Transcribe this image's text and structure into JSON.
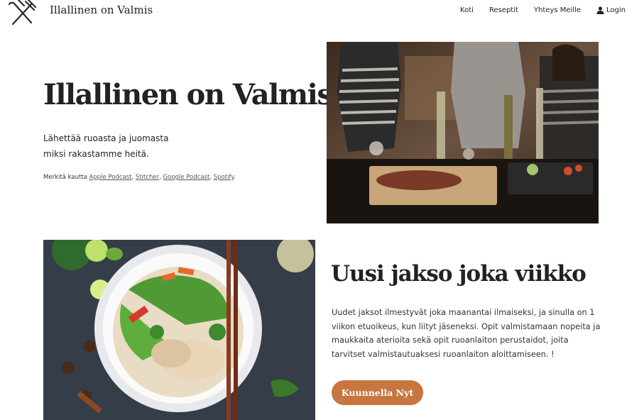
{
  "header": {
    "brand": "Illallinen on Valmis",
    "logo_icon": "fork-and-knife-icon",
    "nav": [
      {
        "label": "Koti"
      },
      {
        "label": "Reseptit"
      },
      {
        "label": "Yhteys Meille"
      }
    ],
    "login_label": "Login",
    "login_icon": "user-icon"
  },
  "hero": {
    "title": "Illallinen on Valmis",
    "subtitle_line1": "Lähettää ruoasta ja juomasta",
    "subtitle_line2": "miksi rakastamme heitä.",
    "subscribe_prefix": "Merkitä kautta",
    "platforms": [
      "Apple Podcast",
      "Stitcher",
      "Google Podcast",
      "Spotify"
    ],
    "separator": ",",
    "end": "."
  },
  "episode": {
    "title": "Uusi jakso joka viikko",
    "text": "Uudet jaksot ilmestyvät joka maanantai ilmaiseksi, ja sinulla on 1 viikon etuoikeus, kun liityt jäseneksi. Opit valmistamaan nopeita ja maukkaita aterioita sekä opit ruoanlaiton perustaidot, joita tarvitset valmistautuaksesi ruoanlaiton aloittamiseen. !",
    "button_label": "Kuunnella Nyt"
  },
  "colors": {
    "accent": "#c8763f",
    "text": "#222222"
  }
}
